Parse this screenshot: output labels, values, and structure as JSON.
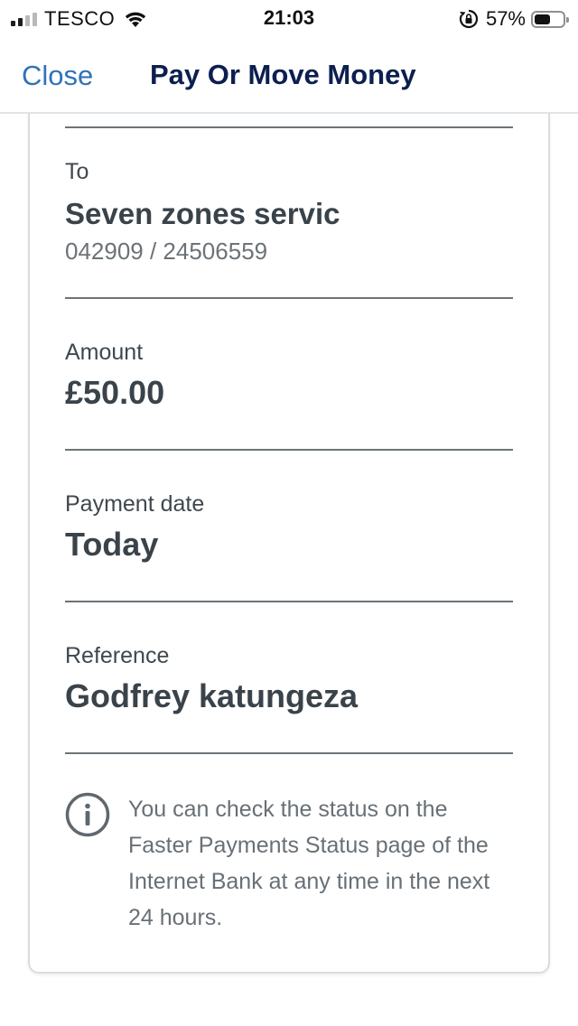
{
  "status_bar": {
    "carrier": "TESCO",
    "time": "21:03",
    "battery_percent": "57%",
    "battery_level": 0.57,
    "icons": [
      "signal-icon",
      "wifi-icon",
      "rotation-lock-icon",
      "battery-icon"
    ]
  },
  "nav": {
    "close_label": "Close",
    "title": "Pay Or Move Money"
  },
  "details": {
    "to_label": "To",
    "payee_name": "Seven zones servic",
    "payee_account": "042909 / 24506559",
    "amount_label": "Amount",
    "amount_value": "£50.00",
    "date_label": "Payment date",
    "date_value": "Today",
    "reference_label": "Reference",
    "reference_value": "Godfrey katungeza"
  },
  "info": {
    "icon": "info-icon",
    "text": "You can check the status on the Faster Payments Status page of the Internet Bank at any time in the next 24 hours."
  },
  "colors": {
    "accent_link": "#2f73b9",
    "title_navy": "#0c1f4f",
    "text_dark": "#3a434a",
    "text_muted": "#687076"
  }
}
